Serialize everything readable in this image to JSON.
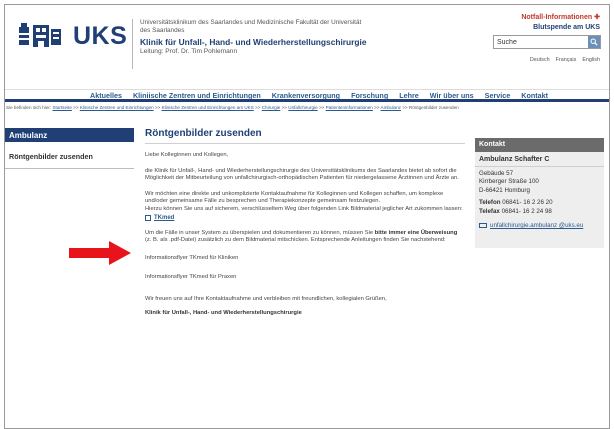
{
  "header": {
    "logo_text": "UKS",
    "university": "Universitätsklinikum des Saarlandes und Medizinische Fakultät der Universität des Saarlandes",
    "clinic": "Klinik für Unfall-, Hand- und Wiederherstellungschirurgie",
    "head": "Leitung: Prof. Dr. Tim Pohlemann",
    "emergency": "Notfall-Informationen",
    "blood": "Blutspende am UKS",
    "search_placeholder": "Suche",
    "languages": [
      "Deutsch",
      "Français",
      "English"
    ]
  },
  "nav": {
    "items": [
      "Aktuelles",
      "Kliniische Zentren und Einrichtungen",
      "Krankenversorgung",
      "Forschung",
      "Lehre",
      "Wir über uns",
      "Service",
      "Kontakt"
    ]
  },
  "breadcrumb": {
    "prefix": "Sie befinden sich hier:",
    "links": [
      "Startseite",
      "Klinische Zentren und Einrichtungen",
      "Klinische Zentren und Einrichtungen am UKS",
      "Chirurgie",
      "Unfallchirurgie",
      "Patienteninformationen",
      "Ambulanz"
    ],
    "current": "Röntgenbilder zusenden",
    "separator": ">>"
  },
  "sidebar": {
    "title": "Ambulanz",
    "items": [
      {
        "label": "Röntgenbilder zusenden"
      }
    ]
  },
  "main": {
    "title": "Röntgenbilder zusenden",
    "salutation": "Liebe Kolleginnen und Kollegen,",
    "p1": "die Klinik für Unfall-, Hand- und Wiederherstellungschirurgie des Universitätsklinikums des Saarlandes bietet ab sofort die Möglichkeit der Mitbeurteilung von unfallchirurgisch-orthopädischen Patienten für niedergelassene Ärztinnen und Ärzte an.",
    "p2a": "Wir möchten eine direkte und unkomplizierte Kontaktaufnahme für Kolleginnen und Kollegen schaffen, um komplexe und/oder gemeinsame Fälle zu besprechen und Therapiekonzepte gemeinsam festzulegen.",
    "p2b": "Hierzu können Sie uns auf sicherem, verschlüsseltem Weg über folgenden Link Bildmaterial jeglicher Art zukommen lassen:",
    "tk_link": "TKmed",
    "p3_pre": "Um die Fälle in unser System zu überspielen und dokumentieren zu können, müssen Sie",
    "p3_bold": "bitte immer eine Überweisung",
    "p3_post": "(z. B. als .pdf-Datei) zusätzlich zu dem Bildmaterial mitschicken. Entsprechende Anleitungen finden Sie nachstehend:",
    "flyer1": "Informationsflyer TKmed für Kliniken",
    "flyer2": "Informationsflyer TKmed für Praxen",
    "closing": "Wir freuen uns auf Ihre Kontaktaufnahme und verbleiben mit freundlichen, kollegialen Grüßen,",
    "signature": "Klinik für Unfall-, Hand- und Wiederherstellungschirurgie"
  },
  "contact": {
    "title": "Kontakt",
    "name": "Ambulanz Schafter C",
    "address": [
      "Gebäude 57",
      "Kirrberger Straße 100",
      "D-66421 Homburg"
    ],
    "tel_label": "Telefon",
    "tel": "06841- 16 2 26 20",
    "fax_label": "Telefax",
    "fax": "06841- 16 2 24 98",
    "email": "unfallchirurgie.ambulanz @uks.eu"
  },
  "colors": {
    "brand": "#1f3f75",
    "link": "#2d5a8e",
    "emergency": "#c0392b",
    "arrow": "#e8141b"
  }
}
